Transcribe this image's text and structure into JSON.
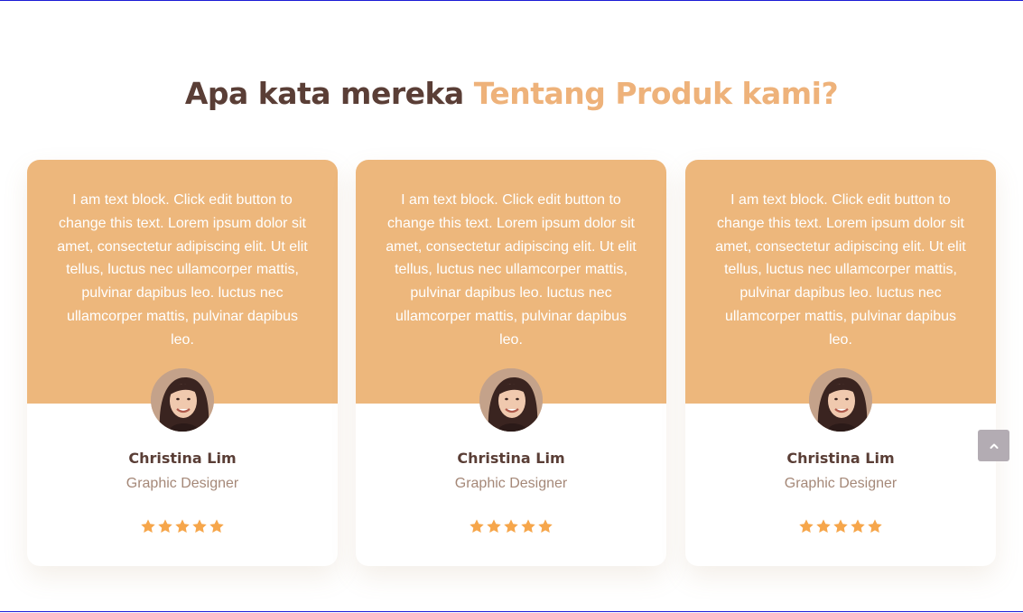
{
  "section": {
    "title_dark": "Apa kata mereka",
    "title_accent": "Tentang Produk kami?",
    "colors": {
      "dark": "#5a3e36",
      "accent": "#eeb27a",
      "card_top": "#edb77c",
      "role": "#a58878",
      "star": "#f6a64b"
    }
  },
  "testimonials": [
    {
      "quote": "I am text block. Click edit button to change this text. Lorem ipsum dolor sit amet, consectetur adipiscing elit. Ut elit tellus, luctus nec ullamcorper mattis, pulvinar dapibus leo. luctus nec ullamcorper mattis, pulvinar dapibus leo.",
      "name": "Christina Lim",
      "role": "Graphic Designer",
      "rating": 5,
      "avatar_icon": "woman-portrait"
    },
    {
      "quote": "I am text block. Click edit button to change this text. Lorem ipsum dolor sit amet, consectetur adipiscing elit. Ut elit tellus, luctus nec ullamcorper mattis, pulvinar dapibus leo. luctus nec ullamcorper mattis, pulvinar dapibus leo.",
      "name": "Christina Lim",
      "role": "Graphic Designer",
      "rating": 5,
      "avatar_icon": "woman-portrait"
    },
    {
      "quote": "I am text block. Click edit button to change this text. Lorem ipsum dolor sit amet, consectetur adipiscing elit. Ut elit tellus, luctus nec ullamcorper mattis, pulvinar dapibus leo. luctus nec ullamcorper mattis, pulvinar dapibus leo.",
      "name": "Christina Lim",
      "role": "Graphic Designer",
      "rating": 5,
      "avatar_icon": "woman-portrait"
    }
  ],
  "back_to_top": {
    "icon": "chevron-up-icon"
  }
}
